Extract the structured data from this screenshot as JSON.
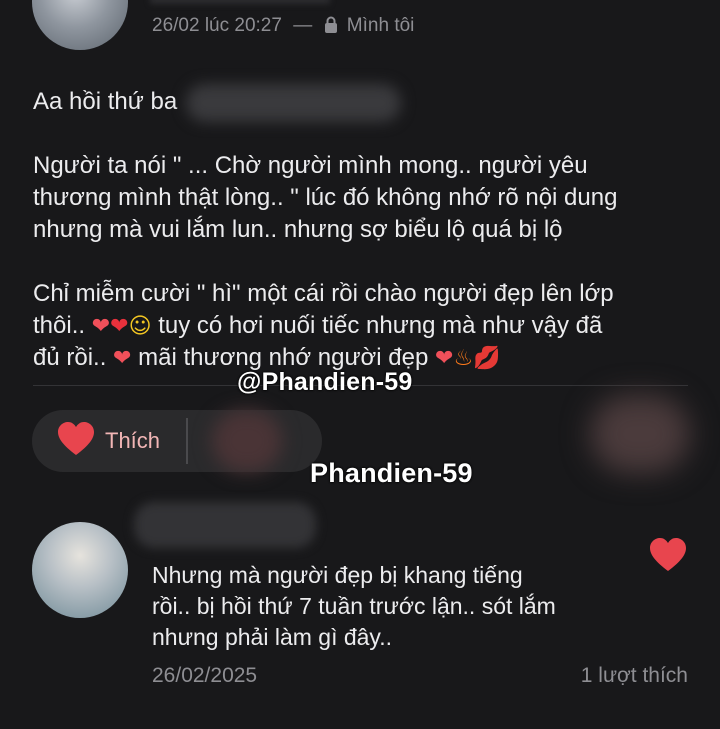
{
  "post": {
    "timestamp": "26/02 lúc 20:27",
    "separator": "—",
    "privacy_label": "Mình tôi",
    "paragraphs": [
      "Aa hồi thứ ba",
      "Người ta nói \" ... Chờ người mình mong.. người yêu thương mình thật lòng.. \" lúc đó không nhớ rõ nội dung nhưng mà vui lắm lun.. nhưng sợ biểu lộ quá bị lộ",
      "Chỉ miễm cười \" hì\" một cái rồi chào người đẹp lên lớp thôi.. ❤️‍🔥❤️🙂 tuy có hơi nuối tiếc nhưng mà như vậy đã đủ rồi.. ❤️‍🔥 mãi thương nhớ người đẹp ❤️‍🔥🔥💋"
    ],
    "lines": {
      "l1": "Aa hồi thứ ba",
      "l2": "Người ta nói \" ... Chờ người mình mong.. người yêu",
      "l3": "thương mình thật lòng.. \" lúc đó không nhớ rõ nội dung",
      "l4": "nhưng mà vui lắm lun.. nhưng sợ biểu lộ quá bị lộ",
      "l5": "Chỉ miễm cười \" hì\" một cái rồi chào người đẹp lên lớp",
      "l6_a": "thôi..",
      "l6_b": "tuy có hơi nuối tiếc nhưng mà như vậy đã",
      "l7_a": "đủ rồi..",
      "l7_b": "mãi thương nhớ người đẹp"
    }
  },
  "watermarks": {
    "handle": "@Phandien-59",
    "name": "Phandien-59"
  },
  "actions": {
    "like_label": "Thích"
  },
  "comment": {
    "lines": [
      "Nhưng mà người đẹp bị khang tiếng",
      "rồi.. bị hồi thứ 7 tuần trước lận.. sót lắm",
      "nhưng phải làm gì đây.."
    ],
    "date": "26/02/2025",
    "likes": "1 lượt thích"
  },
  "colors": {
    "background": "#18181a",
    "heart": "#e8454e",
    "pill": "#2a2a2c"
  }
}
